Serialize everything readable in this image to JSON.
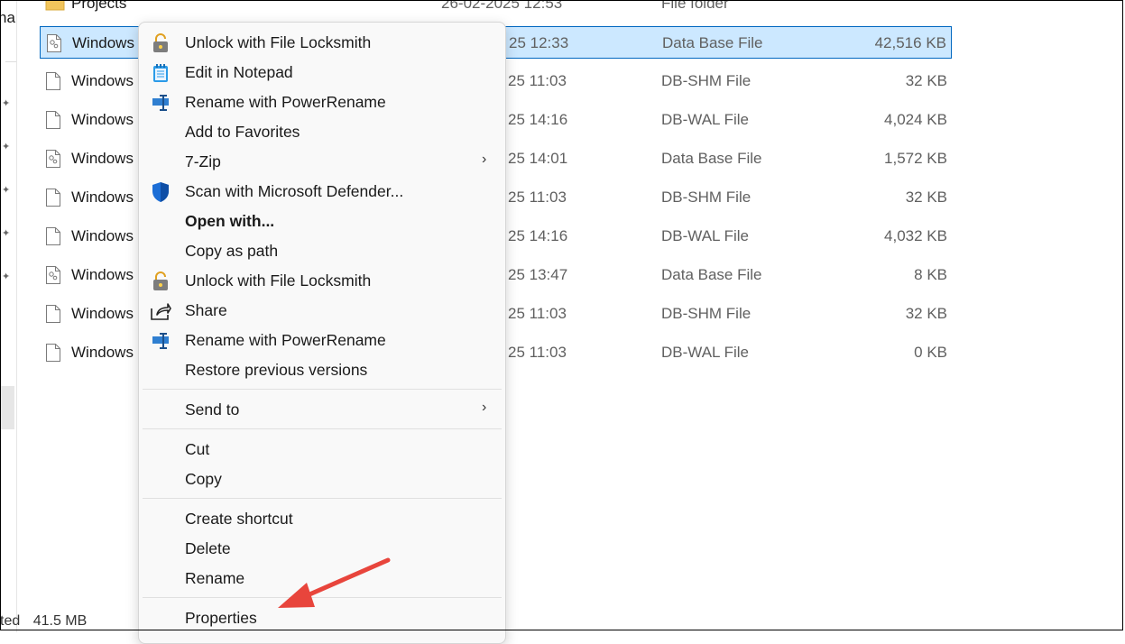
{
  "left_pane": {
    "cut_text": "na",
    "status_items": [
      "ted",
      "41.5 MB"
    ]
  },
  "partial_row": {
    "name": "Projects",
    "date": "26-02-2025 12:53",
    "type": "File folder"
  },
  "files": [
    {
      "name": "Windows",
      "date": "25 12:33",
      "type": "Data Base File",
      "size": "42,516 KB",
      "icon": "gear-file-icon",
      "selected": true
    },
    {
      "name": "Windows",
      "date": "25 11:03",
      "type": "DB-SHM File",
      "size": "32 KB",
      "icon": "blank-file-icon"
    },
    {
      "name": "Windows",
      "date": "25 14:16",
      "type": "DB-WAL File",
      "size": "4,024 KB",
      "icon": "blank-file-icon"
    },
    {
      "name": "Windows",
      "date": "25 14:01",
      "type": "Data Base File",
      "size": "1,572 KB",
      "icon": "gear-file-icon"
    },
    {
      "name": "Windows",
      "date": "25 11:03",
      "type": "DB-SHM File",
      "size": "32 KB",
      "icon": "blank-file-icon"
    },
    {
      "name": "Windows",
      "date": "25 14:16",
      "type": "DB-WAL File",
      "size": "4,032 KB",
      "icon": "blank-file-icon"
    },
    {
      "name": "Windows",
      "date": "25 13:47",
      "type": "Data Base File",
      "size": "8 KB",
      "icon": "gear-file-icon"
    },
    {
      "name": "Windows",
      "date": "25 11:03",
      "type": "DB-SHM File",
      "size": "32 KB",
      "icon": "blank-file-icon"
    },
    {
      "name": "Windows",
      "date": "25 11:03",
      "type": "DB-WAL File",
      "size": "0 KB",
      "icon": "blank-file-icon"
    }
  ],
  "context_menu": {
    "items": [
      {
        "label": "Unlock with File Locksmith",
        "icon": "padlock-icon"
      },
      {
        "label": "Edit in Notepad",
        "icon": "notepad-icon"
      },
      {
        "label": "Rename with PowerRename",
        "icon": "powerrename-icon"
      },
      {
        "label": "Add to Favorites",
        "icon": ""
      },
      {
        "label": "7-Zip",
        "icon": "",
        "submenu": true
      },
      {
        "label": "Scan with Microsoft Defender...",
        "icon": "defender-shield-icon"
      },
      {
        "label": "Open with...",
        "icon": "",
        "bold": true
      },
      {
        "label": "Copy as path",
        "icon": ""
      },
      {
        "label": "Unlock with File Locksmith",
        "icon": "padlock-icon"
      },
      {
        "label": "Share",
        "icon": "share-icon"
      },
      {
        "label": "Rename with PowerRename",
        "icon": "powerrename-icon"
      },
      {
        "label": "Restore previous versions",
        "icon": ""
      },
      {
        "label": "Send to",
        "icon": "",
        "submenu": true
      },
      {
        "label": "Cut",
        "icon": ""
      },
      {
        "label": "Copy",
        "icon": ""
      },
      {
        "label": "Create shortcut",
        "icon": ""
      },
      {
        "label": "Delete",
        "icon": ""
      },
      {
        "label": "Rename",
        "icon": ""
      },
      {
        "label": "Properties",
        "icon": ""
      }
    ],
    "submenu_glyph": "›"
  },
  "annotation": {
    "arrow_color": "#e8453c",
    "points_to": "Properties"
  },
  "colors": {
    "selection_bg": "#cce8ff",
    "selection_border": "#0067c0",
    "folder": "#f2c55c"
  }
}
